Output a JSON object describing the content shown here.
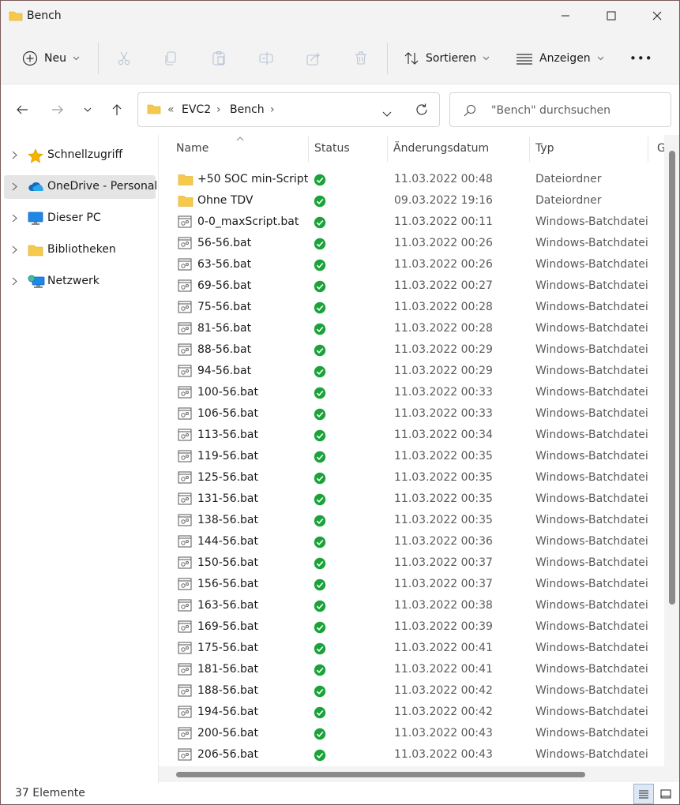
{
  "window": {
    "title": "Bench"
  },
  "toolbar": {
    "new_label": "Neu",
    "sort_label": "Sortieren",
    "view_label": "Anzeigen",
    "more_label": "•••"
  },
  "address": {
    "overflow": "«",
    "crumbs": [
      "EVC2",
      "Bench"
    ],
    "separator": "›"
  },
  "search": {
    "placeholder": "\"Bench\" durchsuchen"
  },
  "sidebar": {
    "items": [
      {
        "label": "Schnellzugriff",
        "icon": "star-icon"
      },
      {
        "label": "OneDrive - Personal",
        "icon": "onedrive-cloud-icon",
        "selected": true
      },
      {
        "label": "Dieser PC",
        "icon": "monitor-icon"
      },
      {
        "label": "Bibliotheken",
        "icon": "folder-icon"
      },
      {
        "label": "Netzwerk",
        "icon": "network-icon"
      }
    ]
  },
  "columns": {
    "name": "Name",
    "status": "Status",
    "date": "Änderungsdatum",
    "type": "Typ",
    "size": "G"
  },
  "files": [
    {
      "name": "+50 SOC min-Script",
      "date": "11.03.2022 00:48",
      "type": "Dateiordner",
      "kind": "folder"
    },
    {
      "name": "Ohne TDV",
      "date": "09.03.2022 19:16",
      "type": "Dateiordner",
      "kind": "folder"
    },
    {
      "name": "0-0_maxScript.bat",
      "date": "11.03.2022 00:11",
      "type": "Windows-Batchdatei",
      "kind": "bat"
    },
    {
      "name": "56-56.bat",
      "date": "11.03.2022 00:26",
      "type": "Windows-Batchdatei",
      "kind": "bat"
    },
    {
      "name": "63-56.bat",
      "date": "11.03.2022 00:26",
      "type": "Windows-Batchdatei",
      "kind": "bat"
    },
    {
      "name": "69-56.bat",
      "date": "11.03.2022 00:27",
      "type": "Windows-Batchdatei",
      "kind": "bat"
    },
    {
      "name": "75-56.bat",
      "date": "11.03.2022 00:28",
      "type": "Windows-Batchdatei",
      "kind": "bat"
    },
    {
      "name": "81-56.bat",
      "date": "11.03.2022 00:28",
      "type": "Windows-Batchdatei",
      "kind": "bat"
    },
    {
      "name": "88-56.bat",
      "date": "11.03.2022 00:29",
      "type": "Windows-Batchdatei",
      "kind": "bat"
    },
    {
      "name": "94-56.bat",
      "date": "11.03.2022 00:29",
      "type": "Windows-Batchdatei",
      "kind": "bat"
    },
    {
      "name": "100-56.bat",
      "date": "11.03.2022 00:33",
      "type": "Windows-Batchdatei",
      "kind": "bat"
    },
    {
      "name": "106-56.bat",
      "date": "11.03.2022 00:33",
      "type": "Windows-Batchdatei",
      "kind": "bat"
    },
    {
      "name": "113-56.bat",
      "date": "11.03.2022 00:34",
      "type": "Windows-Batchdatei",
      "kind": "bat"
    },
    {
      "name": "119-56.bat",
      "date": "11.03.2022 00:35",
      "type": "Windows-Batchdatei",
      "kind": "bat"
    },
    {
      "name": "125-56.bat",
      "date": "11.03.2022 00:35",
      "type": "Windows-Batchdatei",
      "kind": "bat"
    },
    {
      "name": "131-56.bat",
      "date": "11.03.2022 00:35",
      "type": "Windows-Batchdatei",
      "kind": "bat"
    },
    {
      "name": "138-56.bat",
      "date": "11.03.2022 00:35",
      "type": "Windows-Batchdatei",
      "kind": "bat"
    },
    {
      "name": "144-56.bat",
      "date": "11.03.2022 00:36",
      "type": "Windows-Batchdatei",
      "kind": "bat"
    },
    {
      "name": "150-56.bat",
      "date": "11.03.2022 00:37",
      "type": "Windows-Batchdatei",
      "kind": "bat"
    },
    {
      "name": "156-56.bat",
      "date": "11.03.2022 00:37",
      "type": "Windows-Batchdatei",
      "kind": "bat"
    },
    {
      "name": "163-56.bat",
      "date": "11.03.2022 00:38",
      "type": "Windows-Batchdatei",
      "kind": "bat"
    },
    {
      "name": "169-56.bat",
      "date": "11.03.2022 00:39",
      "type": "Windows-Batchdatei",
      "kind": "bat"
    },
    {
      "name": "175-56.bat",
      "date": "11.03.2022 00:41",
      "type": "Windows-Batchdatei",
      "kind": "bat"
    },
    {
      "name": "181-56.bat",
      "date": "11.03.2022 00:41",
      "type": "Windows-Batchdatei",
      "kind": "bat"
    },
    {
      "name": "188-56.bat",
      "date": "11.03.2022 00:42",
      "type": "Windows-Batchdatei",
      "kind": "bat"
    },
    {
      "name": "194-56.bat",
      "date": "11.03.2022 00:42",
      "type": "Windows-Batchdatei",
      "kind": "bat"
    },
    {
      "name": "200-56.bat",
      "date": "11.03.2022 00:43",
      "type": "Windows-Batchdatei",
      "kind": "bat"
    },
    {
      "name": "206-56.bat",
      "date": "11.03.2022 00:43",
      "type": "Windows-Batchdatei",
      "kind": "bat"
    }
  ],
  "status": {
    "count": "37 Elemente"
  },
  "colors": {
    "folder": "#f7c94b",
    "synced": "#1aa33b",
    "accent": "#0f6cbd"
  }
}
